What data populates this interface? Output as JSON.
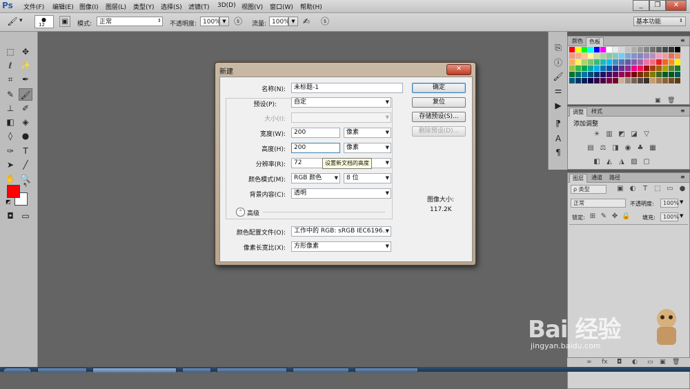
{
  "app": {
    "logo": "Ps"
  },
  "menu": [
    "文件(F)",
    "编辑(E)",
    "图像(I)",
    "图层(L)",
    "类型(Y)",
    "选择(S)",
    "滤镜(T)",
    "3D(D)",
    "视图(V)",
    "窗口(W)",
    "帮助(H)"
  ],
  "window_controls": {
    "minimize": "_",
    "restore": "❐",
    "close": "✕"
  },
  "options": {
    "brush_size": "12",
    "mode_label": "模式:",
    "mode_value": "正常",
    "opacity_label": "不透明度:",
    "opacity_value": "100%",
    "flow_label": "流量:",
    "flow_value": "100%",
    "workspace": "基本功能"
  },
  "panels": {
    "color_tabs": [
      "颜色",
      "色板"
    ],
    "adjust_tabs": [
      "调整",
      "样式"
    ],
    "adjust_title": "添加调整",
    "layers_tabs": [
      "图层",
      "通道",
      "路径"
    ],
    "layers_filter": "ρ 类型",
    "blend_mode": "正常",
    "opacity_label": "不透明度:",
    "opacity_value": "100%",
    "lock_label": "锁定:",
    "fill_label": "填充:",
    "fill_value": "100%"
  },
  "colors": {
    "foreground": "#ff0000",
    "background": "#ffffff",
    "swatches": [
      "#ff0000",
      "#ffff00",
      "#00ff00",
      "#00ffff",
      "#0000ff",
      "#ff00ff",
      "#ffffff",
      "#ebebeb",
      "#d6d6d6",
      "#c2c2c2",
      "#adadad",
      "#999999",
      "#858585",
      "#707070",
      "#5c5c5c",
      "#474747",
      "#333333",
      "#000000",
      "#f7977a",
      "#fbad82",
      "#fdc68c",
      "#fff799",
      "#c6df9c",
      "#a4d49d",
      "#81ca9d",
      "#7bcdc8",
      "#6ecff6",
      "#7ea7d8",
      "#8493ca",
      "#8882be",
      "#a287be",
      "#bc8cbf",
      "#f49bc1",
      "#f5999d",
      "#f26c4f",
      "#f68e56",
      "#fbaf5a",
      "#fff467",
      "#acd372",
      "#7dc473",
      "#3cb878",
      "#1cbbb4",
      "#00bff3",
      "#448ccb",
      "#5574b9",
      "#605ca9",
      "#855fa8",
      "#a763a9",
      "#f06ea9",
      "#f26d7d",
      "#ed1c24",
      "#f26522",
      "#f7941d",
      "#fff200",
      "#8dc63f",
      "#39b54a",
      "#00a651",
      "#00a99d",
      "#00aeef",
      "#0072bc",
      "#0054a6",
      "#2e3192",
      "#662d91",
      "#92278f",
      "#ec008c",
      "#ed145b",
      "#9e0b0f",
      "#a0410d",
      "#a3620a",
      "#aba000",
      "#598527",
      "#1a7b30",
      "#007236",
      "#00746b",
      "#0076a3",
      "#004b80",
      "#003471",
      "#1b1464",
      "#440e62",
      "#630460",
      "#9e005d",
      "#9e0039",
      "#790000",
      "#7b2e00",
      "#7d4900",
      "#827b00",
      "#406618",
      "#005e20",
      "#005826",
      "#005952",
      "#005b7f",
      "#003663",
      "#002157",
      "#0d004c",
      "#32004b",
      "#4b0049",
      "#7b0046",
      "#7a0026",
      "#c7b299",
      "#998675",
      "#736357",
      "#534741",
      "#37302d",
      "#c69c6d",
      "#a67c52",
      "#8c6239",
      "#754c24",
      "#603913"
    ]
  },
  "dialog": {
    "title": "新建",
    "close": "✕",
    "name_label": "名称(N):",
    "name_value": "未标题-1",
    "preset_label": "预设(P):",
    "preset_value": "自定",
    "size_label": "大小(I):",
    "size_value": "",
    "width_label": "宽度(W):",
    "width_value": "200",
    "width_unit": "像素",
    "height_label": "高度(H):",
    "height_value": "200",
    "height_unit": "像素",
    "resolution_label": "分辨率(R):",
    "resolution_value": "72",
    "mode_label": "颜色模式(M):",
    "mode_value": "RGB 颜色",
    "depth_value": "8 位",
    "bg_label": "背景内容(C):",
    "bg_value": "透明",
    "advanced_label": "高级",
    "profile_label": "颜色配置文件(O):",
    "profile_value": "工作中的 RGB: sRGB IEC6196...",
    "aspect_label": "像素长宽比(X):",
    "aspect_value": "方形像素",
    "ok": "确定",
    "reset": "复位",
    "save_preset": "存储预设(S)...",
    "delete_preset": "删除预设(D)...",
    "image_size_label": "图像大小:",
    "image_size_value": "117.2K",
    "tooltip": "设置新文档的高度"
  },
  "watermark": {
    "brand": "Bai 经验",
    "url": "jingyan.baidu.com"
  }
}
